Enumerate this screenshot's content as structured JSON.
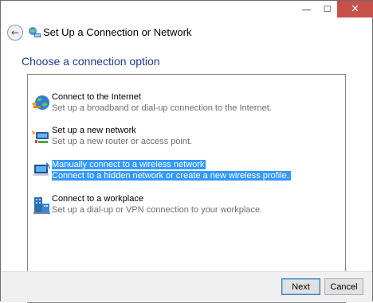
{
  "window": {
    "minimize_glyph": "—",
    "maximize_glyph": "☐",
    "close_glyph": "✕"
  },
  "header": {
    "back_glyph": "←",
    "title": "Set Up a Connection or Network"
  },
  "main": {
    "section_title": "Choose a connection option",
    "options": [
      {
        "title": "Connect to the Internet",
        "description": "Set up a broadband or dial-up connection to the Internet.",
        "icon": "internet-globe-icon",
        "selected": false
      },
      {
        "title": "Set up a new network",
        "description": "Set up a new router or access point.",
        "icon": "new-network-router-icon",
        "selected": false
      },
      {
        "title": "Manually connect to a wireless network",
        "description": "Connect to a hidden network or create a new wireless profile.",
        "icon": "wireless-network-icon",
        "selected": true
      },
      {
        "title": "Connect to a workplace",
        "description": "Set up a dial-up or VPN connection to your workplace.",
        "icon": "workplace-vpn-icon",
        "selected": false
      }
    ]
  },
  "footer": {
    "next_label": "Next",
    "cancel_label": "Cancel"
  },
  "colors": {
    "selection": "#3399ff",
    "title_blue": "#1b3e8f",
    "close_red": "#c7504a"
  }
}
